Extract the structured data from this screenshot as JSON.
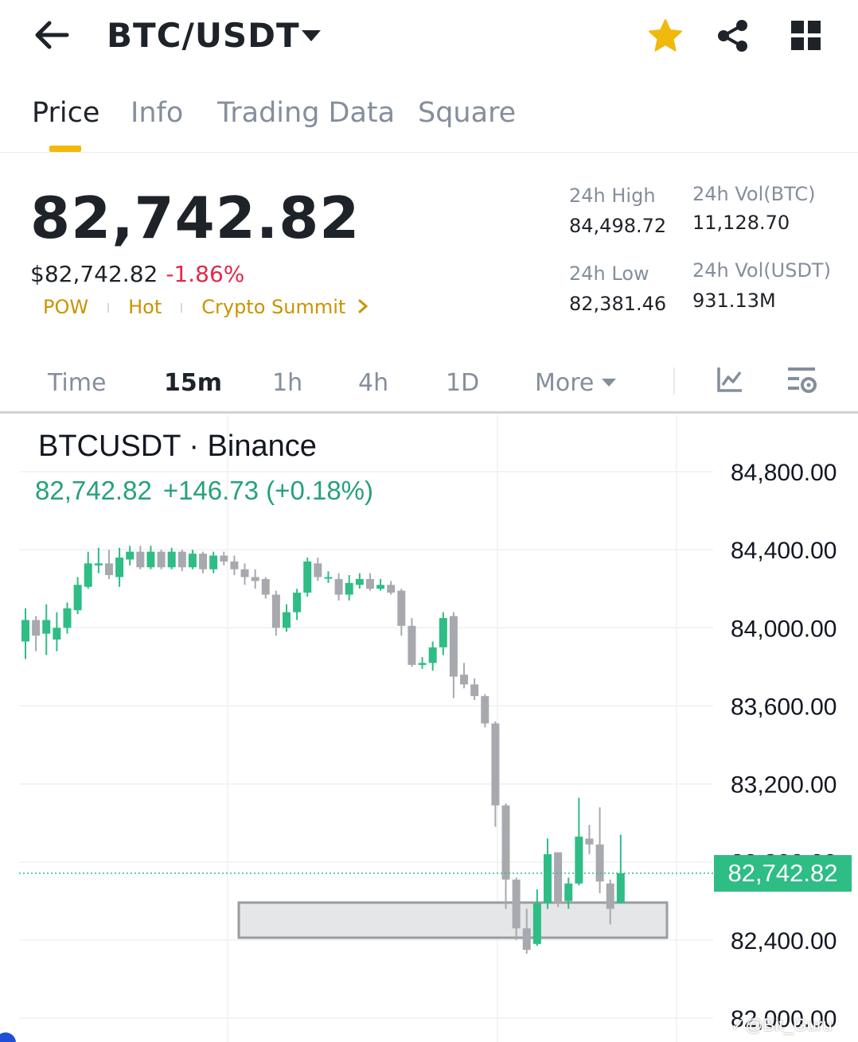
{
  "header": {
    "back_icon": "back-arrow-icon",
    "pair": "BTC/USDT",
    "caret_icon": "caret-down-icon",
    "favorite_icon": "star-icon",
    "favorite_color": "#f0b90b",
    "share_icon": "share-icon",
    "menu_icon": "grid-icon"
  },
  "tabs": [
    {
      "label": "Price",
      "active": true
    },
    {
      "label": "Info",
      "active": false
    },
    {
      "label": "Trading Data",
      "active": false
    },
    {
      "label": "Square",
      "active": false
    }
  ],
  "price": {
    "last": "82,742.82",
    "fiat": "$82,742.82",
    "change_pct": "-1.86%",
    "tags": [
      "POW",
      "Hot",
      "Crypto Summit"
    ],
    "tags_more_icon": "chevron-right-icon"
  },
  "stats": {
    "high_label": "24h High",
    "high_value": "84,498.72",
    "low_label": "24h Low",
    "low_value": "82,381.46",
    "vol_btc_label": "24h Vol(BTC)",
    "vol_btc_value": "11,128.70",
    "vol_usdt_label": "24h Vol(USDT)",
    "vol_usdt_value": "931.13M"
  },
  "intervals": [
    {
      "label": "Time",
      "active": false
    },
    {
      "label": "15m",
      "active": true
    },
    {
      "label": "1h",
      "active": false
    },
    {
      "label": "4h",
      "active": false
    },
    {
      "label": "1D",
      "active": false
    },
    {
      "label": "More",
      "active": false
    }
  ],
  "interval_tools": {
    "more_caret_icon": "caret-down-icon",
    "indicator_icon": "indicator-chart-icon",
    "settings_icon": "chart-settings-icon"
  },
  "colors": {
    "up": "#2ebd85",
    "down": "#a7a9ae",
    "negative_text": "#e0294a",
    "accent": "#f0b90b",
    "tag_text": "#c99400"
  },
  "chart_data": {
    "type": "candlestick",
    "symbol": "BTCUSDT · Binance",
    "ohlc_last": "82,742.82",
    "ohlc_change": "+146.73 (+0.18%)",
    "current_price": 82742.82,
    "current_price_label": "82,742.82",
    "ylim": [
      82000,
      84800
    ],
    "y_ticks": [
      "84,800.00",
      "84,400.00",
      "84,000.00",
      "83,600.00",
      "83,200.00",
      "82,800.00",
      "82,400.00",
      "82,000.00"
    ],
    "grid": true,
    "highlight_zone": [
      82412,
      82592
    ],
    "candles": [
      [
        83930,
        84040,
        84100,
        83840
      ],
      [
        84040,
        83960,
        84060,
        83880
      ],
      [
        83970,
        84040,
        84120,
        83860
      ],
      [
        83940,
        84000,
        84080,
        83880
      ],
      [
        84000,
        84100,
        84130,
        83970
      ],
      [
        84090,
        84220,
        84260,
        84070
      ],
      [
        84210,
        84330,
        84390,
        84200
      ],
      [
        84320,
        84330,
        84410,
        84280
      ],
      [
        84330,
        84270,
        84400,
        84250
      ],
      [
        84260,
        84360,
        84410,
        84210
      ],
      [
        84350,
        84390,
        84420,
        84320
      ],
      [
        84390,
        84310,
        84420,
        84300
      ],
      [
        84310,
        84390,
        84420,
        84300
      ],
      [
        84390,
        84310,
        84400,
        84300
      ],
      [
        84310,
        84390,
        84410,
        84300
      ],
      [
        84390,
        84310,
        84400,
        84290
      ],
      [
        84310,
        84380,
        84400,
        84300
      ],
      [
        84380,
        84300,
        84390,
        84280
      ],
      [
        84300,
        84370,
        84390,
        84280
      ],
      [
        84370,
        84340,
        84390,
        84320
      ],
      [
        84340,
        84300,
        84370,
        84270
      ],
      [
        84300,
        84260,
        84330,
        84220
      ],
      [
        84260,
        84240,
        84300,
        84200
      ],
      [
        84250,
        84170,
        84260,
        84150
      ],
      [
        84170,
        84000,
        84190,
        83960
      ],
      [
        84000,
        84080,
        84120,
        83980
      ],
      [
        84080,
        84180,
        84200,
        84040
      ],
      [
        84180,
        84340,
        84360,
        84160
      ],
      [
        84330,
        84260,
        84360,
        84240
      ],
      [
        84260,
        84260,
        84290,
        84230
      ],
      [
        84250,
        84170,
        84280,
        84140
      ],
      [
        84170,
        84230,
        84270,
        84140
      ],
      [
        84220,
        84250,
        84280,
        84200
      ],
      [
        84250,
        84200,
        84280,
        84190
      ],
      [
        84200,
        84220,
        84250,
        84190
      ],
      [
        84220,
        84180,
        84240,
        84170
      ],
      [
        84190,
        84010,
        84200,
        83960
      ],
      [
        84010,
        83810,
        84050,
        83800
      ],
      [
        83810,
        83820,
        83850,
        83790
      ],
      [
        83820,
        83900,
        83930,
        83780
      ],
      [
        83900,
        84050,
        84080,
        83860
      ],
      [
        84060,
        83750,
        84080,
        83640
      ],
      [
        83760,
        83710,
        83820,
        83690
      ],
      [
        83710,
        83650,
        83740,
        83630
      ],
      [
        83650,
        83510,
        83660,
        83490
      ],
      [
        83510,
        83090,
        83520,
        82980
      ],
      [
        83090,
        82710,
        83100,
        82560
      ],
      [
        82710,
        82460,
        82720,
        82400
      ],
      [
        82460,
        82350,
        82560,
        82330
      ],
      [
        82380,
        82590,
        82660,
        82370
      ],
      [
        82590,
        82840,
        82920,
        82560
      ],
      [
        82850,
        82590,
        82850,
        82570
      ],
      [
        82600,
        82690,
        82720,
        82560
      ],
      [
        82690,
        82930,
        83130,
        82680
      ],
      [
        82920,
        82890,
        82990,
        82840
      ],
      [
        82890,
        82700,
        83080,
        82640
      ],
      [
        82690,
        82560,
        82710,
        82480
      ],
      [
        82590,
        82742.82,
        82940,
        82590
      ]
    ]
  },
  "watermark": "✓@Bit_Guru"
}
